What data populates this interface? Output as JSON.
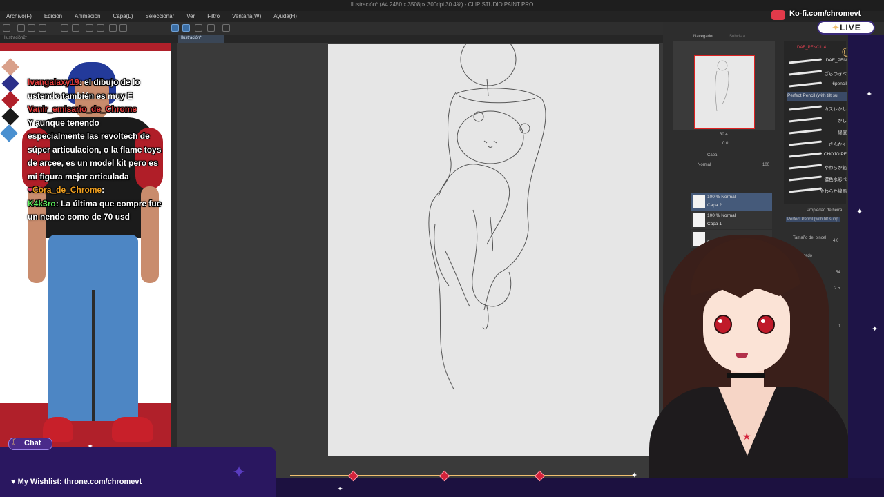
{
  "app": {
    "window_title": "Ilustración* (A4 2480 x 3508px 300dpi 30.4%) - CLIP STUDIO PAINT PRO",
    "menu": [
      "Archivo(F)",
      "Edición",
      "Animación",
      "Capa(L)",
      "Seleccionar",
      "Ver",
      "Filtro",
      "Ventana(W)",
      "Ayuda(H)"
    ],
    "tabs": [
      "Ilustración2*",
      "Ilustración*"
    ]
  },
  "navigator": {
    "tab_label": "Navegador",
    "tab_label_2": "Subvista",
    "zoom": "30.4",
    "angle": "0.0"
  },
  "layers": {
    "tab_label": "Capa",
    "blend_mode": "Normal",
    "opacity": "100",
    "items": [
      {
        "line1": "100 % Normal",
        "line2": "Capa 2"
      },
      {
        "line1": "100 % Normal",
        "line2": "Capa 1"
      },
      {
        "line1": "",
        "line2": "Pa"
      }
    ]
  },
  "brushes": {
    "header": "DAE_PENCIL 4",
    "items": [
      "DAE_PEN",
      "ざらつきペ",
      "6pencil",
      "Perfect Pencil (with tilt su",
      "カスレかし",
      "かし",
      "綿選",
      "さんかく",
      "CHOJO PE",
      "やわらか鉛",
      "濃色水彩ペ",
      "やわらか線画"
    ]
  },
  "tool_property": {
    "title": "Propiedad de herra",
    "brush_name": "Perfect Pencil (with tilt supp",
    "brush_size_label": "Tamaño del pincel",
    "brush_size": "4.0",
    "smoothing_label": "Suavizado",
    "density_value": "54",
    "value_2": "2.5",
    "value_3": "0"
  },
  "chat": {
    "messages": [
      {
        "user": "Ivangalaxy19",
        "text": ": el dibujo de lo ustendo también es muy E"
      },
      {
        "user": "Vanir_emisario_de_Chrome",
        "text": ""
      },
      {
        "user": "",
        "text": "Y aunque tenendo"
      },
      {
        "user": "",
        "text": "especialmente las revoltech de súper articulacion, o la flame toys de arcee, es un model kit pero es mi figura mejor articulada"
      },
      {
        "user": "Cora_de_Chrome",
        "text": ":"
      },
      {
        "user": "K4k3ro",
        "text": ": La última que compre fue un nendo como de 70 usd"
      }
    ]
  },
  "overlay": {
    "chat_label": "Chat",
    "wishlist": "My Wishlist: throne.com/chromevt",
    "kofi": "Ko-fi.com/chromevt",
    "live": "LIVE"
  },
  "colors": {
    "accent_red": "#b0202a",
    "overlay_purple": "#2a1760",
    "layer_selected": "#455a7a"
  }
}
